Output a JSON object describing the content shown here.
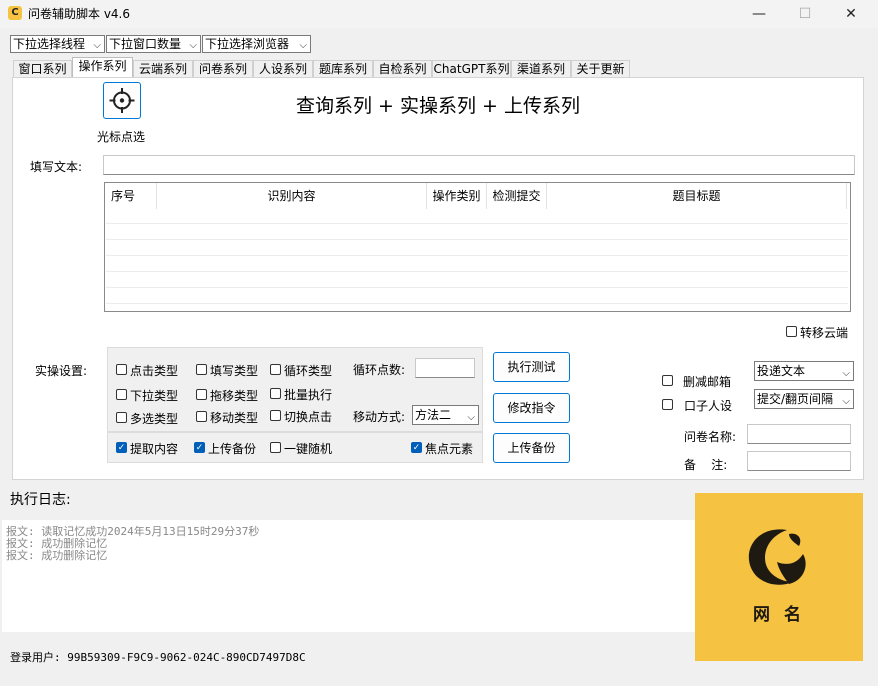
{
  "window": {
    "title": "问卷辅助脚本 v4.6",
    "app_icon_glyph": "C",
    "minimize_glyph": "—",
    "maximize_glyph": "☐",
    "close_glyph": "✕"
  },
  "toolbar": {
    "combos": [
      {
        "value": "下拉选择线程"
      },
      {
        "value": "下拉窗口数量"
      },
      {
        "value": "下拉选择浏览器"
      }
    ]
  },
  "tabs": [
    {
      "label": "窗口系列"
    },
    {
      "label": "操作系列",
      "active": true
    },
    {
      "label": "云端系列"
    },
    {
      "label": "问卷系列"
    },
    {
      "label": "人设系列"
    },
    {
      "label": "题库系列"
    },
    {
      "label": "自检系列"
    },
    {
      "label": "ChatGPT系列"
    },
    {
      "label": "渠道系列"
    },
    {
      "label": "关于更新"
    }
  ],
  "operation": {
    "cursor_pick_label": "光标点选",
    "heading": "查询系列 + 实操系列 + 上传系列",
    "fill_text_label": "填写文本:",
    "fill_text_value": "",
    "table": {
      "columns": [
        "序号",
        "识别内容",
        "操作类别",
        "检测提交",
        "题目标题"
      ]
    },
    "transfer_cloud_label": "转移云端",
    "practice_label": "实操设置:",
    "checkboxes": {
      "click_type": "点击类型",
      "fill_type": "填写类型",
      "loop_type": "循环类型",
      "dropdown_type": "下拉类型",
      "drag_type": "拖移类型",
      "batch_exec": "批量执行",
      "multi_type": "多选类型",
      "move_type": "移动类型",
      "switch_click": "切换点击",
      "extract_content": "提取内容",
      "upload_backup": "上传备份",
      "one_key_random": "一键随机",
      "focus_element": "焦点元素"
    },
    "loop_points_label": "循环点数:",
    "loop_points_value": "",
    "move_mode_label": "移动方式:",
    "move_mode_value": "方法二",
    "buttons": {
      "execute_test": "执行测试",
      "modify_command": "修改指令",
      "upload_backup": "上传备份"
    },
    "right": {
      "delete_email": "删减邮箱",
      "persona": "口子人设",
      "deliver_select": "投递文本",
      "submit_interval_select": "提交/翻页间隔",
      "survey_name_label": "问卷名称:",
      "survey_name_value": "",
      "remark_label": "备    注:",
      "remark_value": ""
    }
  },
  "log": {
    "label": "执行日志:",
    "lines": [
      "报文: 读取记忆成功2024年5月13日15时29分37秒",
      "报文: 成功删除记忆",
      "报文: 成功删除记忆"
    ]
  },
  "status": {
    "login_user": "登录用户: 99B59309-F9C9-9062-024C-890CD7497D8C"
  },
  "promo": {
    "logo_glyph": "C",
    "text": "网 名",
    "bg_color": "#f5c242"
  }
}
